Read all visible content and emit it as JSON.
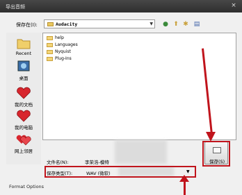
{
  "window": {
    "title": "导出音频",
    "close_symbol": "×"
  },
  "lookin": {
    "label": "保存在(I):",
    "current_folder": "Audacity"
  },
  "toolbar": {
    "back_icon": "back-icon",
    "up_icon": "up-folder-icon",
    "new_folder_icon": "new-folder-icon",
    "view_icon": "view-menu-icon"
  },
  "places": [
    {
      "label": "Recent",
      "icon": "recent-folder-icon"
    },
    {
      "label": "桌面",
      "icon": "desktop-icon"
    },
    {
      "label": "我的文档",
      "icon": "documents-heart-icon"
    },
    {
      "label": "我的电脑",
      "icon": "computer-heart-icon"
    },
    {
      "label": "网上邻居",
      "icon": "network-heart-icon"
    }
  ],
  "files": [
    {
      "name": "help"
    },
    {
      "name": "Languages"
    },
    {
      "name": "Nyquist"
    },
    {
      "name": "Plug-Ins"
    }
  ],
  "filename": {
    "label": "文件名(N):",
    "value": "李荣浩-模特"
  },
  "filetype": {
    "label": "保存类型(T):",
    "value": "WAV (微软)"
  },
  "buttons": {
    "save": "保存(S)"
  },
  "footer": {
    "format_options": "Format Options"
  },
  "colors": {
    "annotation_red": "#c0141c"
  }
}
